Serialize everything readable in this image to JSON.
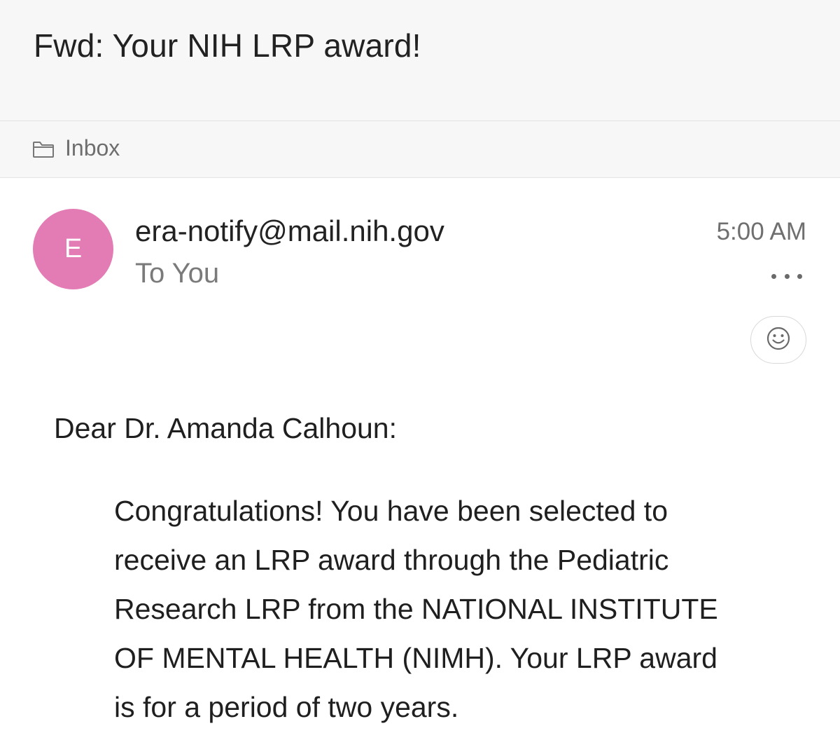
{
  "email": {
    "subject": "Fwd: Your NIH LRP award!",
    "folder": {
      "icon": "folder-icon",
      "label": "Inbox"
    },
    "sender": {
      "avatar_initial": "E",
      "avatar_color": "#e37bb4",
      "address": "era-notify@mail.nih.gov",
      "recipient": "To You",
      "time": "5:00 AM"
    },
    "actions": {
      "more_icon": "more-options-icon",
      "react_icon": "smiley-icon"
    },
    "body": {
      "greeting": "Dear Dr. Amanda Calhoun:",
      "paragraph_lines": [
        "Congratulations! You have been selected to",
        "receive an LRP award through the Pediatric",
        "Research LRP from the NATIONAL INSTITUTE",
        "OF MENTAL HEALTH (NIMH). Your LRP award",
        "is for a period of two years."
      ]
    }
  }
}
